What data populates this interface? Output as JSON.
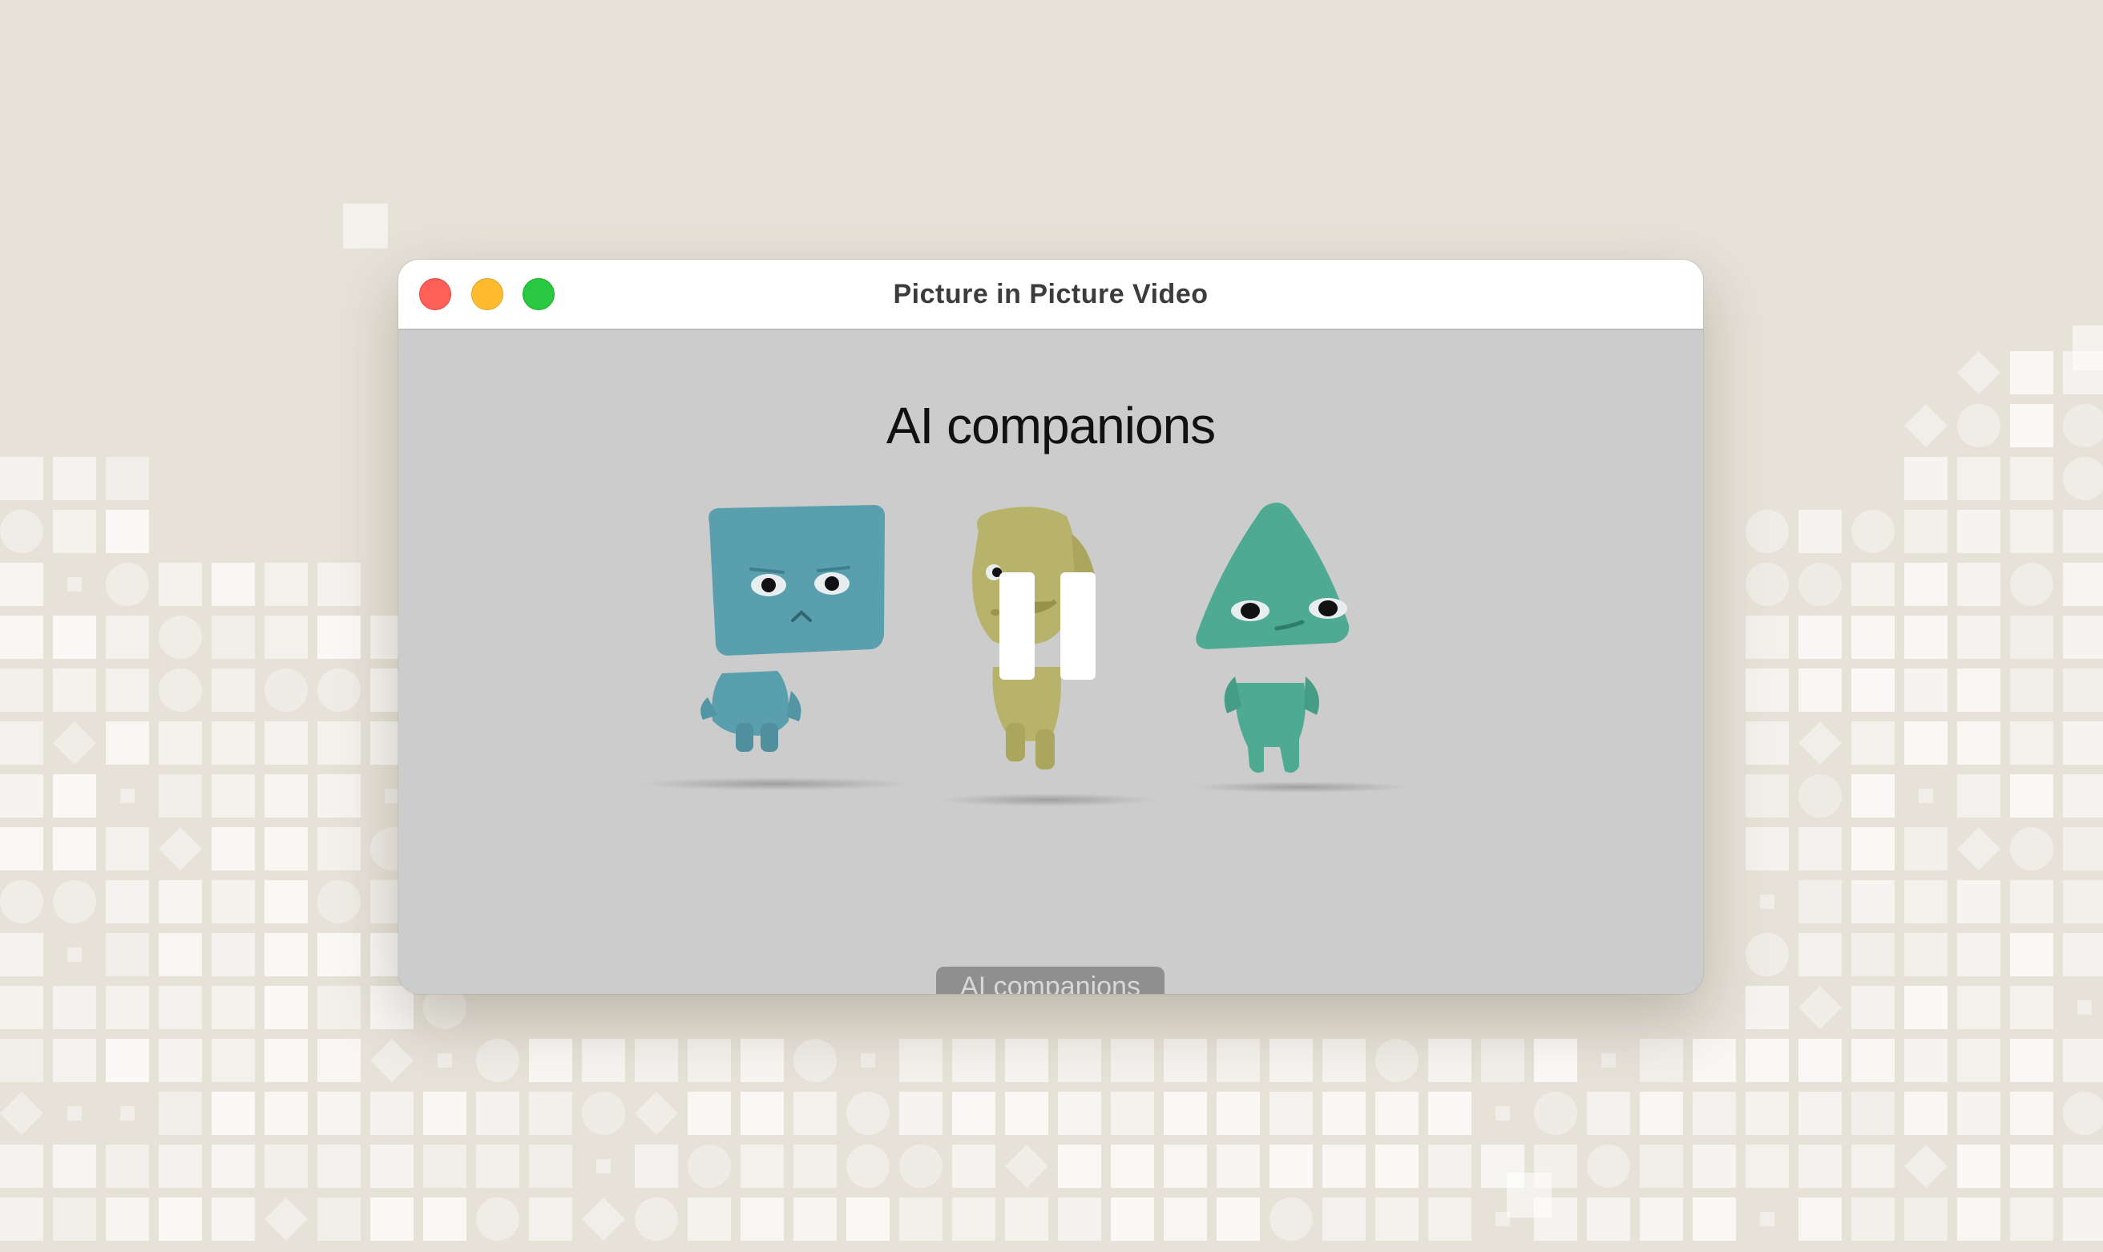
{
  "window": {
    "title": "Picture in Picture Video",
    "controls": [
      "close",
      "minimize",
      "zoom"
    ]
  },
  "video": {
    "heading": "AI companions",
    "caption": "AI companions",
    "state": "playing",
    "overlay_icon": "pause-icon",
    "characters": [
      {
        "name": "blue-square-head-character",
        "color": "#5a9fae"
      },
      {
        "name": "yellow-character",
        "color": "#b8b36a"
      },
      {
        "name": "green-cone-head-character",
        "color": "#4eaa92"
      }
    ]
  },
  "colors": {
    "background": "#e6e2d8",
    "video_background": "#cccccc",
    "close": "#fe5f57",
    "minimize": "#febc2e",
    "zoom": "#28c840"
  }
}
